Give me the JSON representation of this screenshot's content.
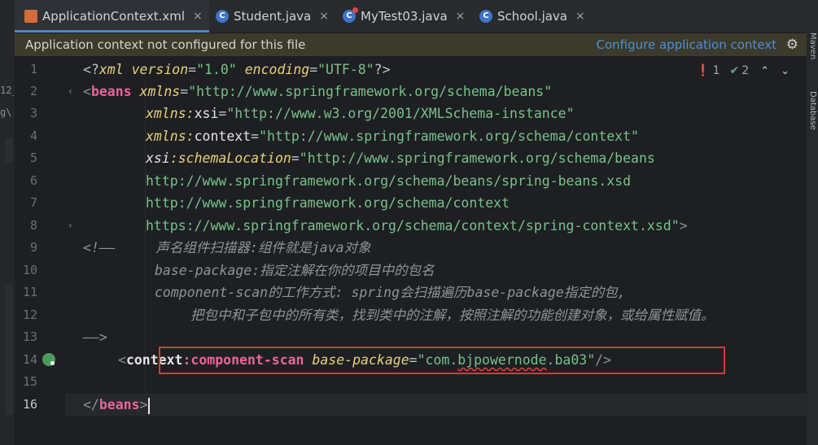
{
  "left_strip": {
    "fragments": [
      "12_",
      "g\\"
    ]
  },
  "right_strip": {
    "labels": [
      "Maven",
      "Database"
    ]
  },
  "tabs": [
    {
      "label": "ApplicationContext.xml",
      "icon": "xml-file-icon",
      "active": true
    },
    {
      "label": "Student.java",
      "icon": "java-class-icon",
      "active": false
    },
    {
      "label": "MyTest03.java",
      "icon": "java-test-class-icon",
      "active": false
    },
    {
      "label": "School.java",
      "icon": "java-class-icon",
      "active": false
    }
  ],
  "close_glyph": "×",
  "banner": {
    "message": "Application context not configured for this file",
    "action": "Configure application context",
    "gear": "⚙"
  },
  "indicators": {
    "error_icon": "❗",
    "errors": "1",
    "ok_icon": "✔",
    "warnings": "2",
    "up": "⌃",
    "down": "⌄"
  },
  "line_numbers": [
    "1",
    "2",
    "3",
    "4",
    "5",
    "6",
    "7",
    "8",
    "9",
    "10",
    "11",
    "12",
    "13",
    "14",
    "15",
    "16"
  ],
  "code": {
    "l1": {
      "a": "<?",
      "b": "xml ",
      "c": "version",
      "d": "=",
      "e": "\"1.0\"",
      "f": " encoding",
      "g": "=",
      "h": "\"UTF-8\"",
      "i": "?>"
    },
    "l2": {
      "a": "<",
      "b": "beans",
      "c": " xmlns",
      "d": "=",
      "e": "\"http://www.springframework.org/schema/beans\""
    },
    "l3": {
      "a": "xmlns",
      "b": ":",
      "c": "xsi",
      "d": "=",
      "e": "\"http://www.w3.org/2001/XMLSchema-instance\""
    },
    "l4": {
      "a": "xmlns",
      "b": ":",
      "c": "context",
      "d": "=",
      "e": "\"http://www.springframework.org/schema/context\""
    },
    "l5": {
      "a": "xsi",
      "b": ":",
      "c": "schemaLocation",
      "d": "=",
      "e": "\"http://www.springframework.org/schema/beans"
    },
    "l6": "http://www.springframework.org/schema/beans/spring-beans.xsd",
    "l7": "http://www.springframework.org/schema/context",
    "l8": {
      "a": "https://www.springframework.org/schema/context/spring-context.xsd\"",
      "b": ">"
    },
    "l9": {
      "a": "<!——",
      "b": "     声名组件扫描器:组件就是java对象"
    },
    "l10": "base-package:指定注解在你的项目中的包名",
    "l11": "component-scan的工作方式: spring会扫描遍历base-package指定的包,",
    "l12": "把包中和子包中的所有类，找到类中的注解，按照注解的功能创建对象，或给属性赋值。",
    "l13": "——>",
    "l14": {
      "a": "<",
      "b": "context",
      "c": ":",
      "d": "component-scan",
      "e": " base-package",
      "f": "=",
      "g": "\"com.",
      "h": "bjpowernode",
      "i": ".ba03\"",
      "j": "/>"
    },
    "l16": {
      "a": "</",
      "b": "beans",
      "c": ">"
    }
  },
  "colors": {
    "tag": "#e8659b",
    "attr": "#e6d27a",
    "value": "#77c28a",
    "link": "#4c8fd6",
    "error_box": "#d23b3b"
  }
}
